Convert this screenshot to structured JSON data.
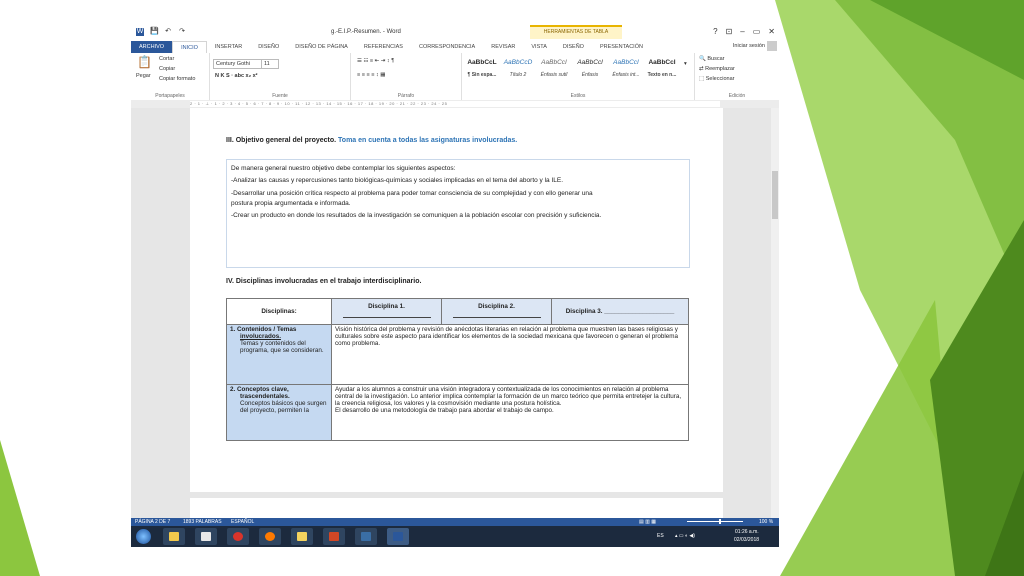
{
  "app": {
    "quick_access_icons": [
      "word-logo-icon",
      "save-icon",
      "undo-icon",
      "redo-icon"
    ],
    "doc_title": "g.-E.I.P.-Resumen. - Word",
    "tools_tab": "HERRAMIENTAS DE TABLA",
    "window_controls": [
      "?",
      "⊡",
      "–",
      "▭",
      "✕"
    ]
  },
  "tabs": [
    "ARCHIVO",
    "INICIO",
    "INSERTAR",
    "DISEÑO",
    "DISEÑO DE PÁGINA",
    "REFERENCIAS",
    "CORRESPONDENCIA",
    "REVISAR",
    "VISTA",
    "DISEÑO",
    "PRESENTACIÓN"
  ],
  "signin": "Iniciar sesión",
  "ribbon": {
    "clipboard": {
      "paste": "Pegar",
      "cut": "Cortar",
      "copy": "Copiar",
      "format": "Copiar formato",
      "label": "Portapapeles"
    },
    "font": {
      "name": "Century Gothi",
      "size": "11",
      "label": "Fuente",
      "buttons": "N  K  S  ·  abc  x₂  x²"
    },
    "paragraph": {
      "label": "Párrafo"
    },
    "styles": {
      "label": "Estilos",
      "items": [
        {
          "sample": "AaBbCcL",
          "name": "¶ Sin espa..."
        },
        {
          "sample": "AaBbCcD",
          "name": "Título 2"
        },
        {
          "sample": "AaBbCcI",
          "name": "Énfasis sutil"
        },
        {
          "sample": "AaBbCcl",
          "name": "Énfasis"
        },
        {
          "sample": "AaBbCcI",
          "name": "Énfasis int..."
        },
        {
          "sample": "AaBbCcI",
          "name": "Texto en n..."
        }
      ]
    },
    "editing": {
      "find": "Buscar",
      "replace": "Reemplazar",
      "select": "Seleccionar",
      "label": "Edición"
    }
  },
  "ruler": "2 · 1 · ⊥ · 1 · 2 · 3 · 4 · 5 · 6 · 7 · 8 · 9 · 10 · 11 · 12 · 13 · 14 · 15 · 16 · 17 · 18 · 19 · 20 · 21 · 22 · 23 · 24 · 25",
  "document": {
    "section3_title": "III. Objetivo general del proyecto.",
    "section3_hint": "Toma en cuenta a todas las asignaturas  involucradas.",
    "objective_lines": [
      "De manera general nuestro objetivo debe contemplar los siguientes aspectos:",
      "-Analizar las causas y repercusiones tanto biológicas-químicas y sociales implicadas en el tema del aborto y la ILE.",
      "-Desarrollar una posición crítica respecto al problema para poder tomar consciencia de su complejidad y con ello generar una",
      "postura propia argumentada e informada.",
      "-Crear un producto en donde los resultados de la investigación se comuniquen a la población escolar con precisión y suficiencia."
    ],
    "section4_title": "IV. Disciplinas involucradas en el  trabajo interdisciplinario.",
    "table": {
      "headers": [
        "Disciplinas:",
        "Disciplina 1.",
        "Disciplina 2.",
        "Disciplina 3. ____________________"
      ],
      "row1": {
        "title_a": "1. Contenidos / Temas",
        "title_b": "involucrados.",
        "desc": "Temas y contenidos  del programa, que se consideran.",
        "text": "Visión histórica del problema y revisión de anécdotas literarias en relación al problema que muestren las bases religiosas y culturales sobre este aspecto para identificar los elementos de la sociedad mexicana que favorecen o generan el problema como problema."
      },
      "row2": {
        "title_a": "2. Conceptos clave,",
        "title_b": "trascendentales.",
        "desc": "Conceptos básicos que surgen  del proyecto, permiten la",
        "text1": "Ayudar a los alumnos a construir una visión integradora y contextualizada de los conocimientos en relación al problema central de la investigación.  Lo anterior implica contemplar la formación de un marco teórico que permita entretejer  la  cultura, la creencia religiosa, los valores y la cosmovisión mediante una postura holística.",
        "text2": "El desarrollo de una metodología de trabajo para abordar el trabajo de campo."
      }
    }
  },
  "status": {
    "page": "PÁGINA 2 DE 7",
    "words": "1893 PALABRAS",
    "language": "ESPAÑOL",
    "zoom": "100 %"
  },
  "taskbar": {
    "lang": "ES",
    "time": "01:26 a.m.",
    "date": "02/03/2018",
    "app_colors": [
      "#f2c94c",
      "#e8e8e8",
      "#d9342b",
      "#ff7a00",
      "#f4d35e",
      "#d24726",
      "#3a6ea5",
      "#2b579a"
    ]
  },
  "colors": {
    "word_blue": "#2b579a",
    "accent_green": "#8cc63f",
    "dark_green": "#4e8a1e",
    "hint_blue": "#2e74b5",
    "header_cell": "#c5d9f1"
  }
}
